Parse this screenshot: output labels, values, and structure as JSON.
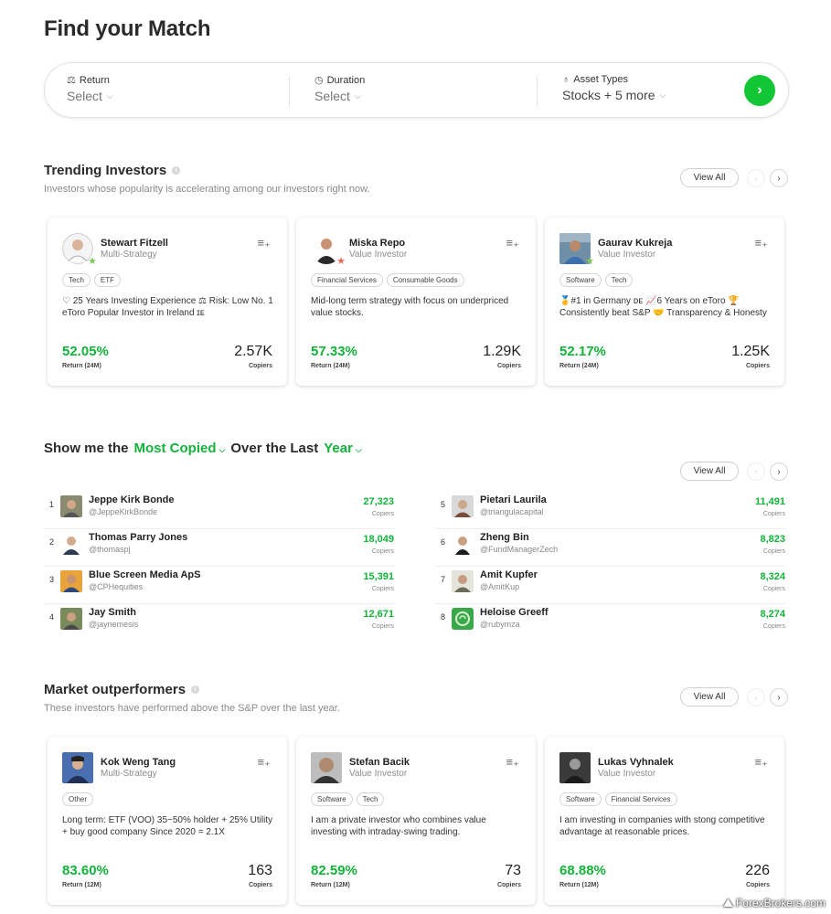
{
  "page_title": "Find your Match",
  "filters": [
    {
      "label": "Return",
      "value": "Select",
      "icon": "scale-icon"
    },
    {
      "label": "Duration",
      "value": "Select",
      "icon": "clock-icon"
    },
    {
      "label": "Asset Types",
      "value": "Stocks + 5 more",
      "icon": "apple-icon"
    }
  ],
  "go_button": "›",
  "trending": {
    "title": "Trending Investors",
    "subtitle": "Investors whose popularity is accelerating among our investors right now.",
    "view_all": "View All",
    "cards": [
      {
        "name": "Stewart Fitzell",
        "type": "Multi-Strategy",
        "tags": [
          "Tech",
          "ETF"
        ],
        "desc": "♡ 25 Years Investing Experience ⚖ Risk: Low No. 1 eToro Popular Investor in Ireland ɪᴇ",
        "return": "52.05%",
        "return_label": "Return (24M)",
        "copiers": "2.57K",
        "copiers_label": "Copiers"
      },
      {
        "name": "Miska Repo",
        "type": "Value Investor",
        "tags": [
          "Financial Services",
          "Consumable Goods"
        ],
        "desc": "Mid-long term strategy with focus on underpriced value stocks.",
        "return": "57.33%",
        "return_label": "Return (24M)",
        "copiers": "1.29K",
        "copiers_label": "Copiers"
      },
      {
        "name": "Gaurav Kukreja",
        "type": "Value Investor",
        "tags": [
          "Software",
          "Tech"
        ],
        "desc": "🥇#1 in Germany ᴅᴇ 📈6 Years on eToro 🏆 Consistently beat S&P 🤝 Transparency & Honesty",
        "return": "52.17%",
        "return_label": "Return (24M)",
        "copiers": "1.25K",
        "copiers_label": "Copiers"
      }
    ]
  },
  "showme": {
    "prefix": "Show me the",
    "metric": "Most Copied",
    "middle": "Over the Last",
    "period": "Year",
    "view_all": "View All"
  },
  "ranking": [
    {
      "rank": "1",
      "name": "Jeppe Kirk Bonde",
      "handle": "@JeppeKirkBonde",
      "copiers": "27,323",
      "label": "Copiers"
    },
    {
      "rank": "2",
      "name": "Thomas Parry Jones",
      "handle": "@thomaspj",
      "copiers": "18,049",
      "label": "Copiers"
    },
    {
      "rank": "3",
      "name": "Blue Screen Media ApS",
      "handle": "@CPHequities",
      "copiers": "15,391",
      "label": "Copiers"
    },
    {
      "rank": "4",
      "name": "Jay Smith",
      "handle": "@jaynemesis",
      "copiers": "12,671",
      "label": "Copiers"
    },
    {
      "rank": "5",
      "name": "Pietari Laurila",
      "handle": "@triangulacapital",
      "copiers": "11,491",
      "label": "Copiers"
    },
    {
      "rank": "6",
      "name": "Zheng Bin",
      "handle": "@FundManagerZech",
      "copiers": "8,823",
      "label": "Copiers"
    },
    {
      "rank": "7",
      "name": "Amit Kupfer",
      "handle": "@AmitKup",
      "copiers": "8,324",
      "label": "Copiers"
    },
    {
      "rank": "8",
      "name": "Heloise Greeff",
      "handle": "@rubymza",
      "copiers": "8,274",
      "label": "Copiers"
    }
  ],
  "outperformers": {
    "title": "Market outperformers",
    "subtitle": "These investors have performed above the S&P over the last year.",
    "view_all": "View All",
    "cards": [
      {
        "name": "Kok Weng Tang",
        "type": "Multi-Strategy",
        "tags": [
          "Other"
        ],
        "desc": "Long term: ETF (VOO) 35~50% holder + 25% Utility + buy good company Since 2020 = 2.1X",
        "return": "83.60%",
        "return_label": "Return (12M)",
        "copiers": "163",
        "copiers_label": "Copiers"
      },
      {
        "name": "Stefan Bacik",
        "type": "Value Investor",
        "tags": [
          "Software",
          "Tech"
        ],
        "desc": "I am a private investor who combines value investing with intraday-swing trading.",
        "return": "82.59%",
        "return_label": "Return (12M)",
        "copiers": "73",
        "copiers_label": "Copiers"
      },
      {
        "name": "Lukas Vyhnalek",
        "type": "Value Investor",
        "tags": [
          "Software",
          "Financial Services"
        ],
        "desc": "I am investing in companies with stong competitive advantage at reasonable prices.",
        "return": "68.88%",
        "return_label": "Return (12M)",
        "copiers": "226",
        "copiers_label": "Copiers"
      }
    ]
  },
  "watermark": "ForexBrokers.com",
  "colors": {
    "accent_green": "#13b33a",
    "button_green": "#13c636"
  }
}
